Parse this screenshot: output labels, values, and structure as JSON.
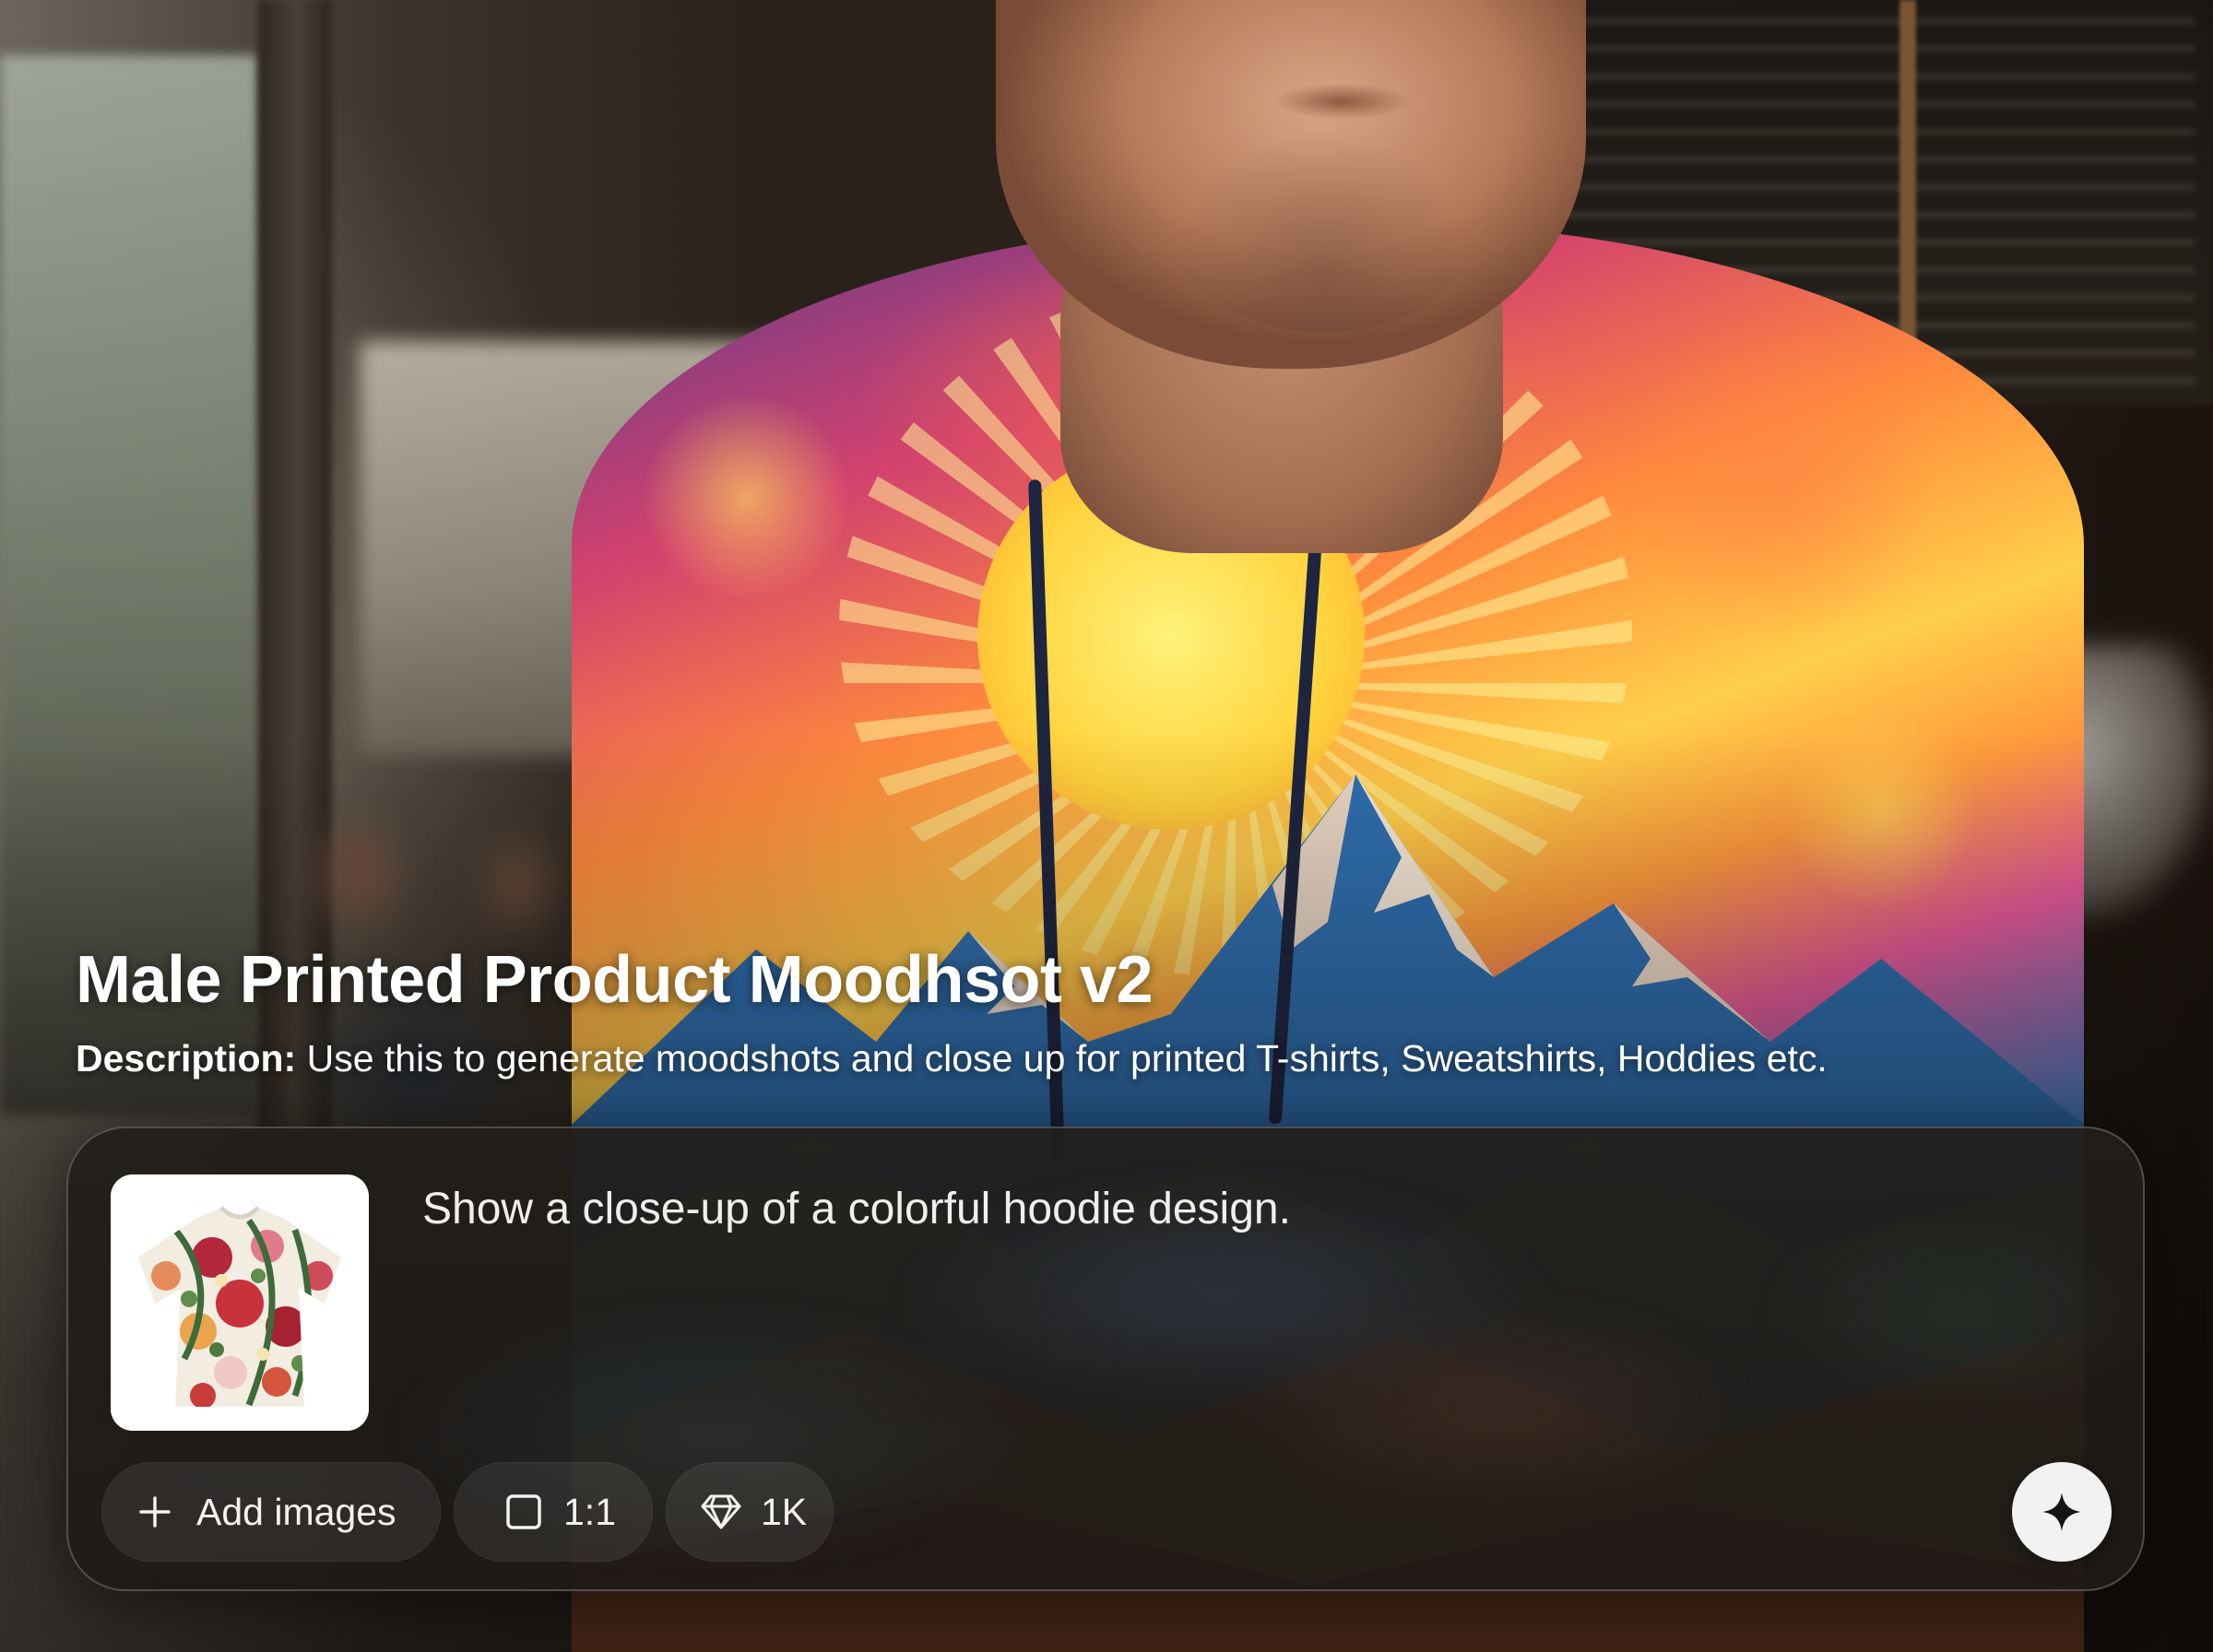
{
  "template": {
    "title": "Male Printed Product Moodhsot v2",
    "description_label": "Description:",
    "description_text": " Use this to generate moodshots and close up for printed T-shirts, Sweatshirts, Hoddies etc."
  },
  "composer": {
    "prompt_text": "Show a close-up of a colorful hoodie design.",
    "reference_image_icon": "floral-tshirt-thumbnail",
    "add_images_label": "Add images",
    "add_images_icon": "plus-icon",
    "aspect_ratio_label": "1:1",
    "aspect_ratio_icon": "square-icon",
    "resolution_label": "1K",
    "resolution_icon": "diamond-icon",
    "generate_icon": "sparkle-icon"
  },
  "colors": {
    "panel_bg": "#211d1b",
    "chip_bg": "#353130",
    "send_button_bg": "#f2f2f2",
    "text": "#ffffff"
  }
}
